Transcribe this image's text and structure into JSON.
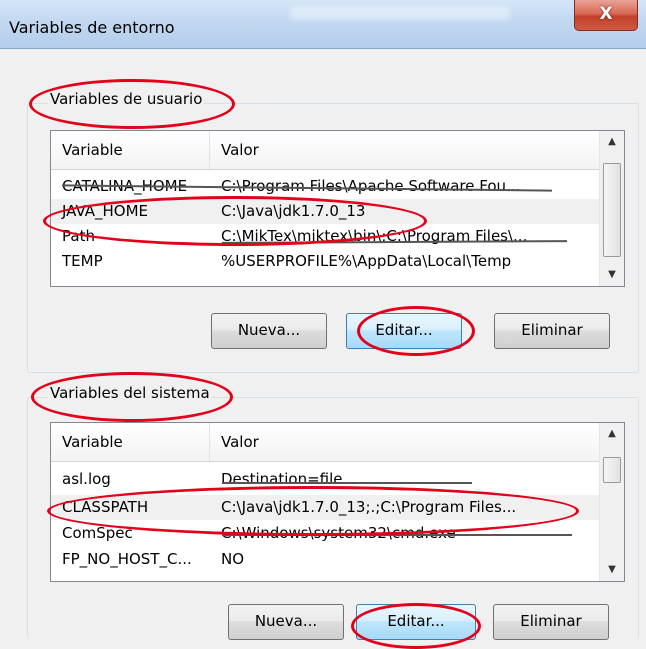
{
  "window": {
    "title": "Variables de entorno",
    "close_label": "X"
  },
  "user_vars": {
    "legend": "Variables de usuario",
    "columns": [
      "Variable",
      "Valor"
    ],
    "rows": [
      {
        "name": "CATALINA_HOME",
        "value": "C:\\Program Files\\Apache Software Fou..."
      },
      {
        "name": "JAVA_HOME",
        "value": "C:\\Java\\jdk1.7.0_13"
      },
      {
        "name": "Path",
        "value": "C:\\MikTex\\miktex\\bin\\;C:\\Program Files\\..."
      },
      {
        "name": "TEMP",
        "value": "%USERPROFILE%\\AppData\\Local\\Temp"
      }
    ],
    "buttons": {
      "new": "Nueva...",
      "edit": "Editar...",
      "delete": "Eliminar"
    }
  },
  "system_vars": {
    "legend": "Variables del sistema",
    "columns": [
      "Variable",
      "Valor"
    ],
    "rows": [
      {
        "name": "asl.log",
        "value": "Destination=file"
      },
      {
        "name": "CLASSPATH",
        "value": "C:\\Java\\jdk1.7.0_13;.;C:\\Program Files..."
      },
      {
        "name": "ComSpec",
        "value": "C:\\Windows\\system32\\cmd.exe"
      },
      {
        "name": "FP_NO_HOST_C...",
        "value": "NO"
      }
    ],
    "buttons": {
      "new": "Nueva...",
      "edit": "Editar...",
      "delete": "Eliminar"
    }
  },
  "annotation_color": "#e3001b"
}
